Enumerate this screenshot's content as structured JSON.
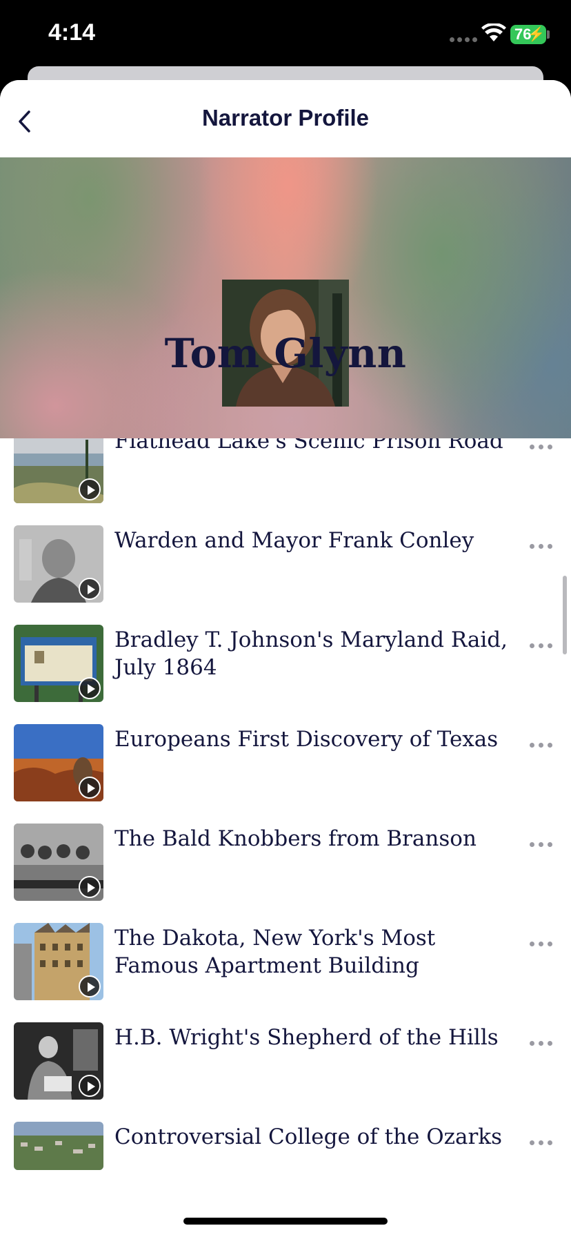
{
  "status_bar": {
    "time": "4:14",
    "battery": "76"
  },
  "header": {
    "title": "Narrator Profile",
    "back_icon": "chevron-left-icon"
  },
  "narrator": {
    "name": "Tom Glynn"
  },
  "tours": [
    {
      "title": "Flathead Lake's Scenic Prison Road",
      "thumb": "lake-landscape"
    },
    {
      "title": "Warden and Mayor Frank Conley",
      "thumb": "portrait-old-man"
    },
    {
      "title": "Bradley T. Johnson's Maryland Raid, July 1864",
      "thumb": "historical-marker"
    },
    {
      "title": "Europeans First Discovery of Texas",
      "thumb": "canyon-landscape"
    },
    {
      "title": "The Bald Knobbers from Branson",
      "thumb": "group-photo"
    },
    {
      "title": "The Dakota, New York's Most Famous Apartment Building",
      "thumb": "building"
    },
    {
      "title": "H.B. Wright's Shepherd of the Hills",
      "thumb": "man-reading"
    },
    {
      "title": "Controversial College of the Ozarks",
      "thumb": "aerial-campus"
    }
  ],
  "colors": {
    "title_navy": "#14163d",
    "battery_green": "#34c759"
  }
}
